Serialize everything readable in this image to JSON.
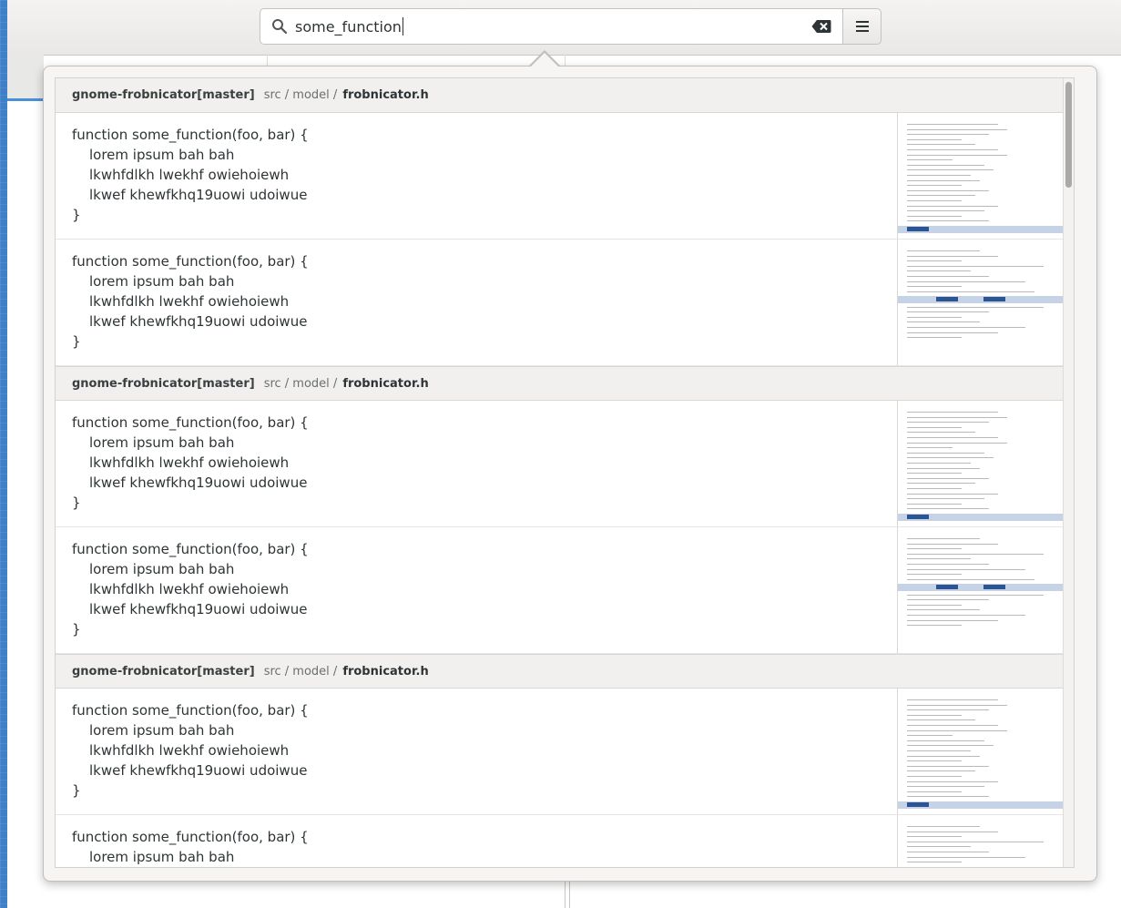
{
  "search": {
    "query": "some_function",
    "icon": "search-icon",
    "clear_icon": "clear-icon"
  },
  "menu": {
    "icon": "hamburger-menu-icon"
  },
  "groups": [
    {
      "repo": "gnome-frobnicator[master]",
      "path": "src / model /",
      "file": "frobnicator.h",
      "results": [
        {
          "lines": [
            "function some_function(foo, bar) {",
            "lorem ipsum bah bah",
            "lkwhfdlkh lwekhf owiehoiewh",
            "lkwef khewfkhq19uowi udoiwue",
            "}"
          ]
        },
        {
          "lines": [
            "function some_function(foo, bar) {",
            "lorem ipsum bah bah",
            "lkwhfdlkh lwekhf owiehoiewh",
            "lkwef khewfkhq19uowi udoiwue",
            "}"
          ]
        }
      ]
    },
    {
      "repo": "gnome-frobnicator[master]",
      "path": "src / model /",
      "file": "frobnicator.h",
      "results": [
        {
          "lines": [
            "function some_function(foo, bar) {",
            "lorem ipsum bah bah",
            "lkwhfdlkh lwekhf owiehoiewh",
            "lkwef khewfkhq19uowi udoiwue",
            "}"
          ]
        },
        {
          "lines": [
            "function some_function(foo, bar) {",
            "lorem ipsum bah bah",
            "lkwhfdlkh lwekhf owiehoiewh",
            "lkwef khewfkhq19uowi udoiwue",
            "}"
          ]
        }
      ]
    },
    {
      "repo": "gnome-frobnicator[master]",
      "path": "src / model /",
      "file": "frobnicator.h",
      "results": [
        {
          "lines": [
            "function some_function(foo, bar) {",
            "lorem ipsum bah bah",
            "lkwhfdlkh lwekhf owiehoiewh",
            "lkwef khewfkhq19uowi udoiwue",
            "}"
          ]
        },
        {
          "lines": [
            "function some_function(foo, bar) {",
            "lorem ipsum bah bah"
          ]
        }
      ]
    }
  ],
  "colors": {
    "accent": "#2a5592",
    "highlight": "#c6d3e6",
    "desktop": "#3f7fc8"
  }
}
